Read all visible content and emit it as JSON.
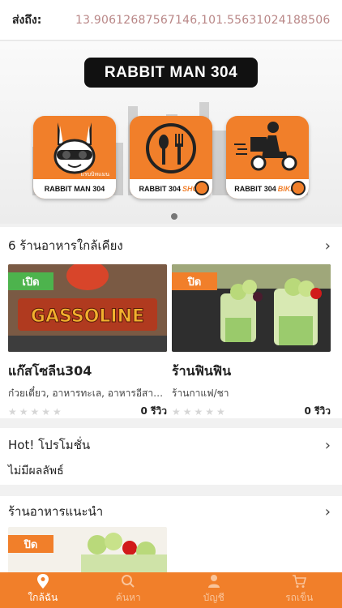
{
  "header": {
    "label": "ส่งถึง:",
    "coords": "13.90612687567146,101.55631024188506"
  },
  "banner": {
    "title": "RABBIT MAN 304",
    "tiles": [
      {
        "caption": "RABBIT MAN 304",
        "sub": "แรบบิทแมน"
      },
      {
        "caption": "RABBIT 304",
        "accent": "SHOP"
      },
      {
        "caption": "RABBIT 304",
        "accent": "BIKER"
      }
    ]
  },
  "nearby": {
    "title": "6  ร้านอาหารใกล้เคียง",
    "cards": [
      {
        "status": "เปิด",
        "name": "แก๊สโซลีน304",
        "category": "ก๋วยเตี๋ยว, อาหารทะเล, อาหารอีสาน...",
        "reviews": "0 รีวิว",
        "image_text": "GASSOLINE"
      },
      {
        "status": "ปิด",
        "name": "ร้านฟินฟิน",
        "category": "ร้านกาแฟ/ชา",
        "reviews": "0 รีวิว"
      }
    ]
  },
  "promo": {
    "title": "Hot! โปรโมชั่น",
    "empty": "ไม่มีผลลัพธ์"
  },
  "recommended": {
    "title": "ร้านอาหารแนะนำ",
    "status": "ปิด"
  },
  "tabs": [
    {
      "label": "ใกล้ฉัน",
      "icon": "location-pin-icon"
    },
    {
      "label": "ค้นหา",
      "icon": "search-icon"
    },
    {
      "label": "บัญชี",
      "icon": "user-icon"
    },
    {
      "label": "รถเข็น",
      "icon": "cart-icon"
    }
  ],
  "colors": {
    "brand": "#f17f2a",
    "open": "#4db34d",
    "coords": "#b98787"
  }
}
